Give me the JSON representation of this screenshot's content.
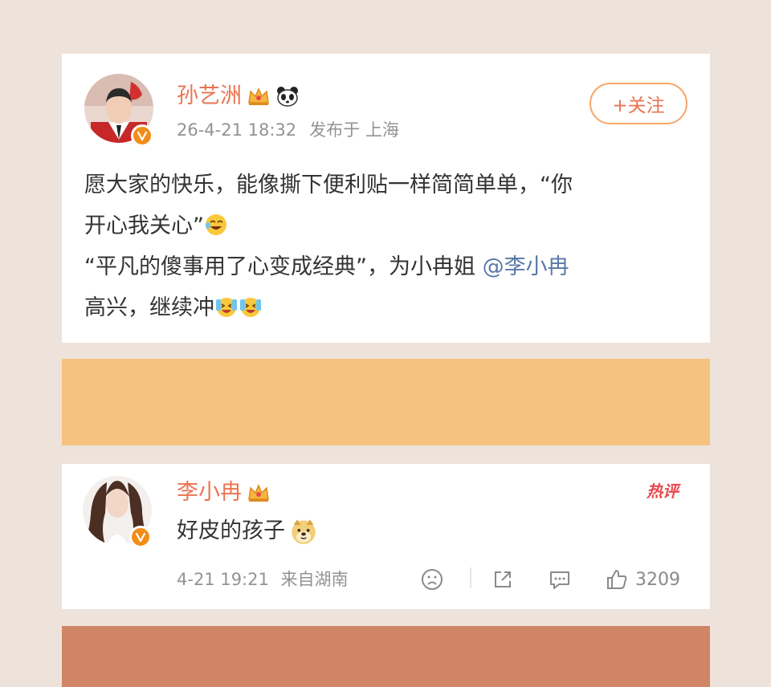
{
  "post": {
    "username": "孙艺洲",
    "timestamp": "26-4-21 18:32",
    "location_label": "发布于 上海",
    "follow_label": "+关注",
    "text_line1": "愿大家的快乐，能像撕下便利贴一样简简单单，“你",
    "text_line2": "开心我关心”",
    "text_line3_a": "“平凡的傻事用了心变成经典”，为小冉姐 ",
    "mention": "@李小冉",
    "text_line4": "高兴，继续冲",
    "icons": [
      "crown-icon",
      "panda-icon",
      "verified-icon",
      "emoji-laugh-tears",
      "emoji-happy-cry"
    ]
  },
  "comment": {
    "username": "李小冉",
    "text": "好皮的孩子",
    "hot_tag": "热评",
    "timestamp": "4-21 19:21",
    "source": "来自湖南",
    "like_count": "3209",
    "icons": [
      "crown-icon",
      "doge-emoji",
      "dislike-icon",
      "share-icon",
      "comment-icon",
      "like-icon"
    ]
  },
  "colors": {
    "background": "#ede3db",
    "username": "#eb7350",
    "orange_band": "#f5c27f",
    "brown_band": "#cf8566",
    "mention": "#5a78a8",
    "hot_tag": "#e8484d"
  }
}
